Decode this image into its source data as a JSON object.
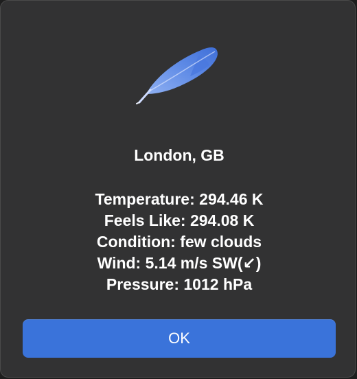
{
  "dialog": {
    "icon": "feather-icon",
    "title": "London, GB",
    "lines": [
      "Temperature: 294.46 K",
      "Feels Like: 294.08 K",
      "Condition: few clouds",
      "Wind: 5.14 m/s SW(↙)",
      "Pressure: 1012 hPa"
    ],
    "ok_label": "OK"
  },
  "colors": {
    "background": "#323233",
    "accent": "#3a73da",
    "text": "#ffffff"
  }
}
